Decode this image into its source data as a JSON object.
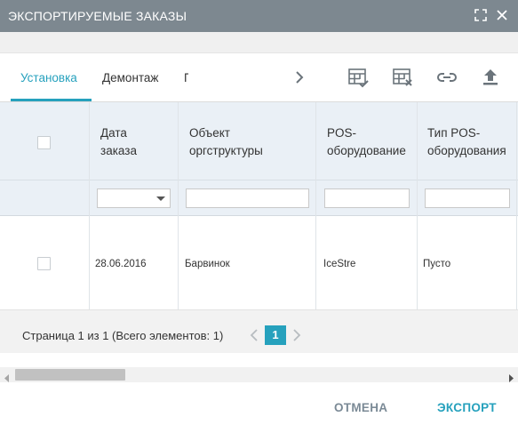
{
  "window": {
    "title": "ЭКСПОРТИРУЕМЫЕ ЗАКАЗЫ",
    "maximize_icon": "maximize-icon",
    "close_icon": "close-icon"
  },
  "tabs": {
    "items": [
      {
        "label": "Установка",
        "active": true
      },
      {
        "label": "Демонтаж",
        "active": false
      },
      {
        "label": "Г",
        "active": false,
        "clipped": true
      }
    ],
    "next_icon": "chevron-right-icon"
  },
  "toolbar": {
    "icons": [
      "table-check-icon",
      "table-delete-icon",
      "link-icon",
      "upload-icon"
    ]
  },
  "grid": {
    "columns": [
      {
        "label": "",
        "type": "checkbox"
      },
      {
        "label": "Дата заказа",
        "lines": [
          "Дата",
          "заказа"
        ]
      },
      {
        "label": "Объект оргструктуры",
        "lines": [
          "Объект",
          "оргструктуры"
        ]
      },
      {
        "label": "POS-оборудование",
        "lines": [
          "POS-",
          "оборудование"
        ]
      },
      {
        "label": "Тип POS-оборудования",
        "lines": [
          "Тип POS-",
          "оборудования"
        ]
      }
    ],
    "filters": [
      {
        "type": "select",
        "value": ""
      },
      {
        "type": "text",
        "value": ""
      },
      {
        "type": "text",
        "value": ""
      },
      {
        "type": "text",
        "value": ""
      }
    ],
    "rows": [
      {
        "checked": false,
        "date": "28.06.2016",
        "object": "Барвинок",
        "pos": "IceStre",
        "pos_type": "Пусто"
      }
    ]
  },
  "pager": {
    "info": "Страница 1 из 1 (Всего элементов: 1)",
    "current_page": "1"
  },
  "footer": {
    "cancel_label": "ОТМЕНА",
    "export_label": "ЭКСПОРТ"
  },
  "colors": {
    "accent": "#26a1bd",
    "titlebar": "#7d8890",
    "header_bg": "#eaf0f6",
    "cancel_text": "#7b8a96"
  }
}
